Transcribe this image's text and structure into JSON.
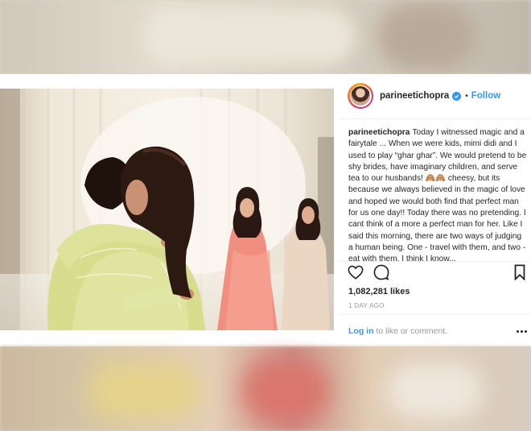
{
  "post": {
    "username": "parineetichopra",
    "follow_label": "Follow",
    "separator": "•",
    "caption_user": "parineetichopra",
    "caption_text": "Today I witnessed magic and a fairytale ... When we were kids, mimi didi and I used to play “ghar ghar”. We would pretend to be shy brides, have imaginary children, and serve tea to our husbands! 🙈🙈 cheesy, but its because we always believed in the magic of love and hoped we would both find that perfect man for us one day!! Today there was no pretending. I cant think of a more a perfect man for her. Like I said this morning, there are two ways of judging a human being. One - travel with them, and two - eat with them. I think I know...",
    "likes": "1,082,281 likes",
    "timestamp": "1 DAY AGO",
    "login_link": "Log in",
    "login_suffix": "to like or comment."
  },
  "icons": {
    "verified": "verified-badge-icon",
    "like": "heart-icon",
    "comment": "comment-bubble-icon",
    "save": "bookmark-icon",
    "more": "more-options-icon"
  },
  "colors": {
    "link_blue": "#3897f0",
    "text_dark": "#262626",
    "text_muted": "#999999"
  }
}
